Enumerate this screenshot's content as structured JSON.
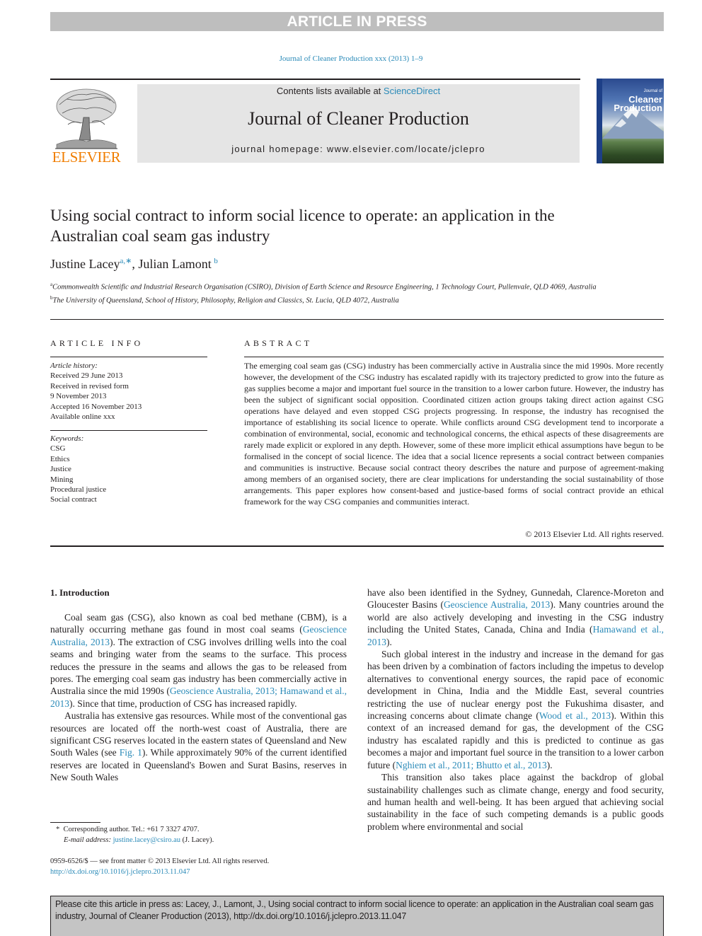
{
  "banner": {
    "text": "ARTICLE IN PRESS"
  },
  "journal_ref": "Journal of Cleaner Production xxx (2013) 1–9",
  "masthead": {
    "contents_prefix": "Contents lists available at ",
    "contents_link": "ScienceDirect",
    "journal_name": "Journal of Cleaner Production",
    "homepage": "journal homepage: www.elsevier.com/locate/jclepro"
  },
  "publisher_logo": {
    "name": "ELSEVIER",
    "icon": "elsevier-tree-icon"
  },
  "cover": {
    "title_line1": "Cleaner",
    "title_line2": "Production",
    "small_title": "Journal of"
  },
  "article": {
    "title": "Using social contract to inform social licence to operate: an application in the Australian coal seam gas industry",
    "authors": [
      {
        "name": "Justine Lacey",
        "marks": "a,∗"
      },
      {
        "name": "Julian Lamont",
        "marks": "b"
      }
    ],
    "author_separator": ", ",
    "affiliations": [
      {
        "mark": "a",
        "text": "Commonwealth Scientific and Industrial Research Organisation (CSIRO), Division of Earth Science and Resource Engineering, 1 Technology Court, Pullenvale, QLD 4069, Australia"
      },
      {
        "mark": "b",
        "text": "The University of Queensland, School of History, Philosophy, Religion and Classics, St. Lucia, QLD 4072, Australia"
      }
    ]
  },
  "article_info": {
    "heading": "ARTICLE INFO",
    "history_label": "Article history:",
    "history": [
      "Received 29 June 2013",
      "Received in revised form",
      "9 November 2013",
      "Accepted 16 November 2013",
      "Available online xxx"
    ],
    "keywords_label": "Keywords:",
    "keywords": [
      "CSG",
      "Ethics",
      "Justice",
      "Mining",
      "Procedural justice",
      "Social contract"
    ]
  },
  "abstract": {
    "heading": "ABSTRACT",
    "text": "The emerging coal seam gas (CSG) industry has been commercially active in Australia since the mid 1990s. More recently however, the development of the CSG industry has escalated rapidly with its trajectory predicted to grow into the future as gas supplies become a major and important fuel source in the transition to a lower carbon future. However, the industry has been the subject of significant social opposition. Coordinated citizen action groups taking direct action against CSG operations have delayed and even stopped CSG projects progressing. In response, the industry has recognised the importance of establishing its social licence to operate. While conflicts around CSG development tend to incorporate a combination of environmental, social, economic and technological concerns, the ethical aspects of these disagreements are rarely made explicit or explored in any depth. However, some of these more implicit ethical assumptions have begun to be formalised in the concept of social licence. The idea that a social licence represents a social contract between companies and communities is instructive. Because social contract theory describes the nature and purpose of agreement-making among members of an organised society, there are clear implications for understanding the social sustainability of those arrangements. This paper explores how consent-based and justice-based forms of social contract provide an ethical framework for the way CSG companies and communities interact.",
    "copyright": "© 2013 Elsevier Ltd. All rights reserved."
  },
  "body": {
    "section_title": "1.  Introduction",
    "left_column": [
      [
        {
          "t": "Coal seam gas (CSG), also known as coal bed methane (CBM), is a naturally occurring methane gas found in most coal seams ("
        },
        {
          "link": "Geoscience Australia, 2013"
        },
        {
          "t": "). The extraction of CSG involves drilling wells into the coal seams and bringing water from the seams to the surface. This process reduces the pressure in the seams and allows the gas to be released from pores. The emerging coal seam gas industry has been commercially active in Australia since the mid 1990s ("
        },
        {
          "link": "Geoscience Australia, 2013; Hamawand et al., 2013"
        },
        {
          "t": "). Since that time, production of CSG has increased rapidly."
        }
      ],
      [
        {
          "t": "Australia has extensive gas resources. While most of the conventional gas resources are located off the north-west coast of Australia, there are significant CSG reserves located in the eastern states of Queensland and New South Wales (see "
        },
        {
          "link": "Fig. 1"
        },
        {
          "t": "). While approximately 90% of the current identified reserves are located in Queensland's Bowen and Surat Basins, reserves in New South Wales"
        }
      ]
    ],
    "right_column": [
      [
        {
          "t": "have also been identified in the Sydney, Gunnedah, Clarence-Moreton and Gloucester Basins ("
        },
        {
          "link": "Geoscience Australia, 2013"
        },
        {
          "t": "). Many countries around the world are also actively developing and investing in the CSG industry including the United States, Canada, China and India ("
        },
        {
          "link": "Hamawand et al., 2013"
        },
        {
          "t": ")."
        }
      ],
      [
        {
          "t": "Such global interest in the industry and increase in the demand for gas has been driven by a combination of factors including the impetus to develop alternatives to conventional energy sources, the rapid pace of economic development in China, India and the Middle East, several countries restricting the use of nuclear energy post the Fukushima disaster, and increasing concerns about climate change ("
        },
        {
          "link": "Wood et al., 2013"
        },
        {
          "t": "). Within this context of an increased demand for gas, the development of the CSG industry has escalated rapidly and this is predicted to continue as gas becomes a major and important fuel source in the transition to a lower carbon future ("
        },
        {
          "link": "Nghiem et al., 2011; Bhutto et al., 2013"
        },
        {
          "t": ")."
        }
      ],
      [
        {
          "t": "This transition also takes place against the backdrop of global sustainability challenges such as climate change, energy and food security, and human health and well-being. It has been argued that achieving social sustainability in the face of such competing demands is a public goods problem where environmental and social"
        }
      ]
    ]
  },
  "footnote": {
    "mark": "*",
    "corresponding": "Corresponding author. Tel.: +61 7 3327 4707.",
    "email_label": "E-mail address: ",
    "email": "justine.lacey@csiro.au",
    "email_suffix": " (J. Lacey)."
  },
  "front_matter": {
    "issn_line": "0959-6526/$ — see front matter © 2013 Elsevier Ltd. All rights reserved.",
    "doi": "http://dx.doi.org/10.1016/j.jclepro.2013.11.047"
  },
  "cite_box": {
    "text": "Please cite this article in press as: Lacey, J., Lamont, J., Using social contract to inform social licence to operate: an application in the Australian coal seam gas industry, Journal of Cleaner Production (2013), http://dx.doi.org/10.1016/j.jclepro.2013.11.047"
  },
  "colors": {
    "link": "#2a8ab8",
    "elsevier_orange": "#f07d00",
    "banner_gray": "#bebebe",
    "masthead_bg": "#e5e5e5"
  }
}
